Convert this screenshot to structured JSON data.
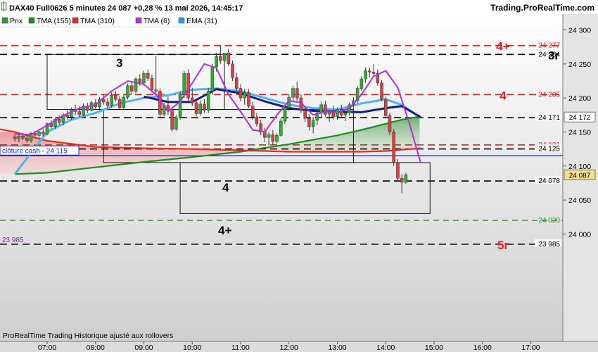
{
  "header": {
    "instrument": "DAX40 Full0626 5 minutes 24 087 +0,28 % 13 mai 2026, 14:45:17",
    "site": "Trading.ProRealTime.com"
  },
  "legend": [
    {
      "label": "Prix",
      "color": "#2e9a2e"
    },
    {
      "label": "TMA (155)",
      "color": "#1e8c1e"
    },
    {
      "label": "TMA (310)",
      "color": "#e0301e"
    },
    {
      "label": "TMA (6)",
      "color": "#b030e0"
    },
    {
      "label": "EMA (31)",
      "color": "#2a9ee8"
    }
  ],
  "footer": {
    "text": "ProRealTime Trading  Historique ajusté aux rollovers"
  },
  "cash_close": {
    "label": "clôture cash -  24 115",
    "value": 24115
  },
  "colors": {
    "up": "#2eae2e",
    "down": "#d94040",
    "wick": "#333333",
    "tma155": "#1e8c1e",
    "tma310": "#e0301e",
    "tma6": "#b030e0",
    "ema31": "#4fb5f0",
    "navy": "#14207a",
    "red_level": "#e02020",
    "green_level": "#1a9a1a",
    "black_level": "#000000",
    "purple": "#7a1ea0"
  },
  "chart_data": {
    "type": "candlestick",
    "title": "DAX40 Full0626 5 minutes",
    "ylim": [
      23940,
      24310
    ],
    "y_ticks": [
      "24 300",
      "24 250",
      "24 200",
      "24 150",
      "24 100",
      "24 050",
      "24 000"
    ],
    "y_tick_values": [
      24300,
      24250,
      24200,
      24150,
      24100,
      24050,
      24000
    ],
    "x_ticks": [
      "07:00",
      "08:00",
      "09:00",
      "10:00",
      "11:00",
      "12:00",
      "13:00",
      "14:00",
      "15:00",
      "16:00",
      "17:00"
    ],
    "levels": [
      {
        "value": 24277,
        "label": "24 277",
        "style": "red",
        "tag": "4+"
      },
      {
        "value": 24264,
        "label": "24 264",
        "style": "black",
        "tag": "3r"
      },
      {
        "value": 24205,
        "label": "24 205",
        "style": "red",
        "tag": "4"
      },
      {
        "value": 24171,
        "label": "24 171",
        "style": "black",
        "tag": ""
      },
      {
        "value": 24131,
        "label": "24 131",
        "style": "red",
        "tag": ""
      },
      {
        "value": 24125,
        "label": "24 125",
        "style": "black",
        "tag": ""
      },
      {
        "value": 24078,
        "label": "24 078",
        "style": "black",
        "tag": ""
      },
      {
        "value": 24020,
        "label": "24 020",
        "style": "green",
        "tag": ""
      },
      {
        "value": 23985,
        "label": "23 985",
        "style": "black",
        "tag": "5r"
      }
    ],
    "left_label": {
      "text": "23 985",
      "value": 23985
    },
    "price_tags": [
      {
        "text": "24 172",
        "value": 24172
      },
      {
        "text": "24 087",
        "value": 24087
      }
    ],
    "boxes": [
      {
        "label": "3",
        "t0": "07:00",
        "t1": "10:40",
        "v_top": 24264,
        "v_bot": 24183
      },
      {
        "label": "4",
        "t0": "08:10",
        "t1": "13:20",
        "v_top": 24183,
        "v_bot": 24105
      },
      {
        "label": "4+",
        "t0": "09:45",
        "t1": "14:55",
        "v_top": 24105,
        "v_bot": 24030
      }
    ],
    "candles_start": "06:20",
    "candle_minutes": 5,
    "candles": [
      [
        24143,
        24147,
        24136,
        24140
      ],
      [
        24140,
        24146,
        24135,
        24144
      ],
      [
        24144,
        24148,
        24138,
        24141
      ],
      [
        24141,
        24145,
        24134,
        24137
      ],
      [
        24137,
        24150,
        24134,
        24148
      ],
      [
        24148,
        24152,
        24143,
        24145
      ],
      [
        24145,
        24152,
        24141,
        24150
      ],
      [
        24150,
        24155,
        24144,
        24147
      ],
      [
        24147,
        24164,
        24145,
        24162
      ],
      [
        24162,
        24167,
        24155,
        24158
      ],
      [
        24158,
        24172,
        24154,
        24169
      ],
      [
        24169,
        24174,
        24160,
        24164
      ],
      [
        24164,
        24178,
        24160,
        24175
      ],
      [
        24175,
        24182,
        24168,
        24172
      ],
      [
        24172,
        24186,
        24168,
        24183
      ],
      [
        24183,
        24190,
        24175,
        24180
      ],
      [
        24180,
        24188,
        24172,
        24175
      ],
      [
        24175,
        24192,
        24173,
        24188
      ],
      [
        24188,
        24193,
        24178,
        24182
      ],
      [
        24182,
        24196,
        24180,
        24193
      ],
      [
        24193,
        24198,
        24184,
        24187
      ],
      [
        24187,
        24201,
        24183,
        24198
      ],
      [
        24198,
        24205,
        24190,
        24194
      ],
      [
        24194,
        24200,
        24185,
        24189
      ],
      [
        24189,
        24208,
        24186,
        24204
      ],
      [
        24204,
        24210,
        24195,
        24198
      ],
      [
        24198,
        24203,
        24183,
        24186
      ],
      [
        24186,
        24206,
        24184,
        24201
      ],
      [
        24201,
        24221,
        24198,
        24218
      ],
      [
        24218,
        24223,
        24205,
        24210
      ],
      [
        24210,
        24231,
        24207,
        24228
      ],
      [
        24228,
        24235,
        24218,
        24222
      ],
      [
        24222,
        24240,
        24219,
        24236
      ],
      [
        24236,
        24242,
        24225,
        24229
      ],
      [
        24229,
        24234,
        24208,
        24212
      ],
      [
        24212,
        24262,
        24205,
        24210
      ],
      [
        24210,
        24214,
        24170,
        24176
      ],
      [
        24176,
        24193,
        24173,
        24189
      ],
      [
        24189,
        24202,
        24175,
        24181
      ],
      [
        24181,
        24185,
        24150,
        24154
      ],
      [
        24154,
        24175,
        24152,
        24171
      ],
      [
        24171,
        24210,
        24168,
        24205
      ],
      [
        24205,
        24240,
        24200,
        24236
      ],
      [
        24236,
        24242,
        24196,
        24200
      ],
      [
        24200,
        24215,
        24188,
        24193
      ],
      [
        24193,
        24199,
        24173,
        24177
      ],
      [
        24177,
        24196,
        24174,
        24191
      ],
      [
        24191,
        24198,
        24178,
        24182
      ],
      [
        24182,
        24215,
        24178,
        24210
      ],
      [
        24210,
        24250,
        24205,
        24246
      ],
      [
        24246,
        24266,
        24239,
        24261
      ],
      [
        24261,
        24278,
        24250,
        24255
      ],
      [
        24255,
        24262,
        24240,
        24266
      ],
      [
        24266,
        24272,
        24247,
        24250
      ],
      [
        24250,
        24255,
        24225,
        24230
      ],
      [
        24230,
        24237,
        24210,
        24214
      ],
      [
        24214,
        24220,
        24195,
        24200
      ],
      [
        24200,
        24213,
        24190,
        24208
      ],
      [
        24208,
        24213,
        24185,
        24188
      ],
      [
        24188,
        24194,
        24168,
        24172
      ],
      [
        24172,
        24178,
        24158,
        24162
      ],
      [
        24162,
        24168,
        24145,
        24150
      ],
      [
        24150,
        24156,
        24135,
        24142
      ],
      [
        24142,
        24150,
        24130,
        24146
      ],
      [
        24146,
        24153,
        24131,
        24136
      ],
      [
        24136,
        24148,
        24133,
        24145
      ],
      [
        24145,
        24170,
        24143,
        24166
      ],
      [
        24166,
        24190,
        24162,
        24186
      ],
      [
        24186,
        24205,
        24181,
        24201
      ],
      [
        24201,
        24218,
        24195,
        24214
      ],
      [
        24214,
        24224,
        24196,
        24200
      ],
      [
        24200,
        24205,
        24178,
        24182
      ],
      [
        24182,
        24188,
        24165,
        24170
      ],
      [
        24170,
        24176,
        24152,
        24158
      ],
      [
        24158,
        24172,
        24148,
        24167
      ],
      [
        24167,
        24183,
        24160,
        24178
      ],
      [
        24178,
        24195,
        24170,
        24190
      ],
      [
        24190,
        24196,
        24172,
        24176
      ],
      [
        24176,
        24182,
        24165,
        24180
      ],
      [
        24180,
        24189,
        24168,
        24172
      ],
      [
        24172,
        24186,
        24168,
        24183
      ],
      [
        24183,
        24190,
        24170,
        24175
      ],
      [
        24175,
        24181,
        24166,
        24178
      ],
      [
        24178,
        24193,
        24174,
        24190
      ],
      [
        24190,
        24201,
        24182,
        24196
      ],
      [
        24196,
        24218,
        24192,
        24214
      ],
      [
        24214,
        24232,
        24210,
        24228
      ],
      [
        24228,
        24245,
        24222,
        24240
      ],
      [
        24240,
        24244,
        24230,
        24238
      ],
      [
        24238,
        24250,
        24232,
        24236
      ],
      [
        24236,
        24242,
        24218,
        24222
      ],
      [
        24222,
        24226,
        24195,
        24198
      ],
      [
        24198,
        24202,
        24170,
        24174
      ],
      [
        24174,
        24178,
        24145,
        24150
      ],
      [
        24150,
        24154,
        24100,
        24105
      ],
      [
        24105,
        24110,
        24078,
        24082
      ],
      [
        24082,
        24088,
        24060,
        24076
      ],
      [
        24076,
        24090,
        24074,
        24087
      ]
    ],
    "tma155": [
      [
        6.33,
        24088
      ],
      [
        7,
        24090
      ],
      [
        8,
        24098
      ],
      [
        9,
        24106
      ],
      [
        10,
        24113
      ],
      [
        11,
        24121
      ],
      [
        12,
        24132
      ],
      [
        13,
        24145
      ],
      [
        13.5,
        24153
      ],
      [
        14,
        24162
      ],
      [
        14.33,
        24168
      ],
      [
        14.72,
        24173
      ]
    ],
    "tma310": [
      [
        6.33,
        24150
      ],
      [
        7,
        24137
      ],
      [
        8,
        24128
      ],
      [
        9,
        24126
      ],
      [
        10,
        24125
      ],
      [
        11,
        24123
      ],
      [
        12,
        24121
      ],
      [
        13,
        24121
      ],
      [
        13.5,
        24121
      ],
      [
        14,
        24122
      ],
      [
        14.33,
        24124
      ],
      [
        14.72,
        24126
      ]
    ],
    "tma6": [
      [
        6.33,
        24147
      ],
      [
        6.67,
        24146
      ],
      [
        7,
        24160
      ],
      [
        7.33,
        24174
      ],
      [
        7.67,
        24185
      ],
      [
        8,
        24190
      ],
      [
        8.33,
        24210
      ],
      [
        8.67,
        24225
      ],
      [
        9,
        24220
      ],
      [
        9.25,
        24205
      ],
      [
        9.5,
        24180
      ],
      [
        9.75,
        24195
      ],
      [
        10,
        24222
      ],
      [
        10.25,
        24250
      ],
      [
        10.5,
        24244
      ],
      [
        10.75,
        24205
      ],
      [
        11,
        24180
      ],
      [
        11.25,
        24153
      ],
      [
        11.5,
        24150
      ],
      [
        11.75,
        24175
      ],
      [
        12,
        24196
      ],
      [
        12.25,
        24193
      ],
      [
        12.5,
        24175
      ],
      [
        12.75,
        24180
      ],
      [
        13,
        24179
      ],
      [
        13.25,
        24185
      ],
      [
        13.5,
        24205
      ],
      [
        13.75,
        24232
      ],
      [
        14,
        24240
      ],
      [
        14.25,
        24215
      ],
      [
        14.5,
        24160
      ],
      [
        14.72,
        24105
      ]
    ],
    "ema31": [
      [
        6.33,
        24088
      ],
      [
        7,
        24150
      ],
      [
        7.5,
        24168
      ],
      [
        8,
        24178
      ],
      [
        8.5,
        24192
      ],
      [
        9,
        24200
      ],
      [
        9.5,
        24204
      ],
      [
        10,
        24212
      ],
      [
        10.5,
        24214
      ],
      [
        11,
        24210
      ],
      [
        11.5,
        24200
      ],
      [
        12,
        24190
      ],
      [
        12.5,
        24185
      ],
      [
        13,
        24183
      ],
      [
        13.5,
        24192
      ],
      [
        14,
        24198
      ],
      [
        14.33,
        24190
      ],
      [
        14.72,
        24171
      ]
    ],
    "navy": [
      [
        9,
        24202
      ],
      [
        9.5,
        24194
      ],
      [
        10,
        24194
      ],
      [
        10.5,
        24213
      ],
      [
        11,
        24207
      ],
      [
        11.5,
        24195
      ],
      [
        12,
        24185
      ],
      [
        12.5,
        24181
      ],
      [
        13,
        24180
      ],
      [
        13.5,
        24179
      ],
      [
        14,
        24185
      ],
      [
        14.33,
        24188
      ],
      [
        14.72,
        24172
      ]
    ]
  }
}
